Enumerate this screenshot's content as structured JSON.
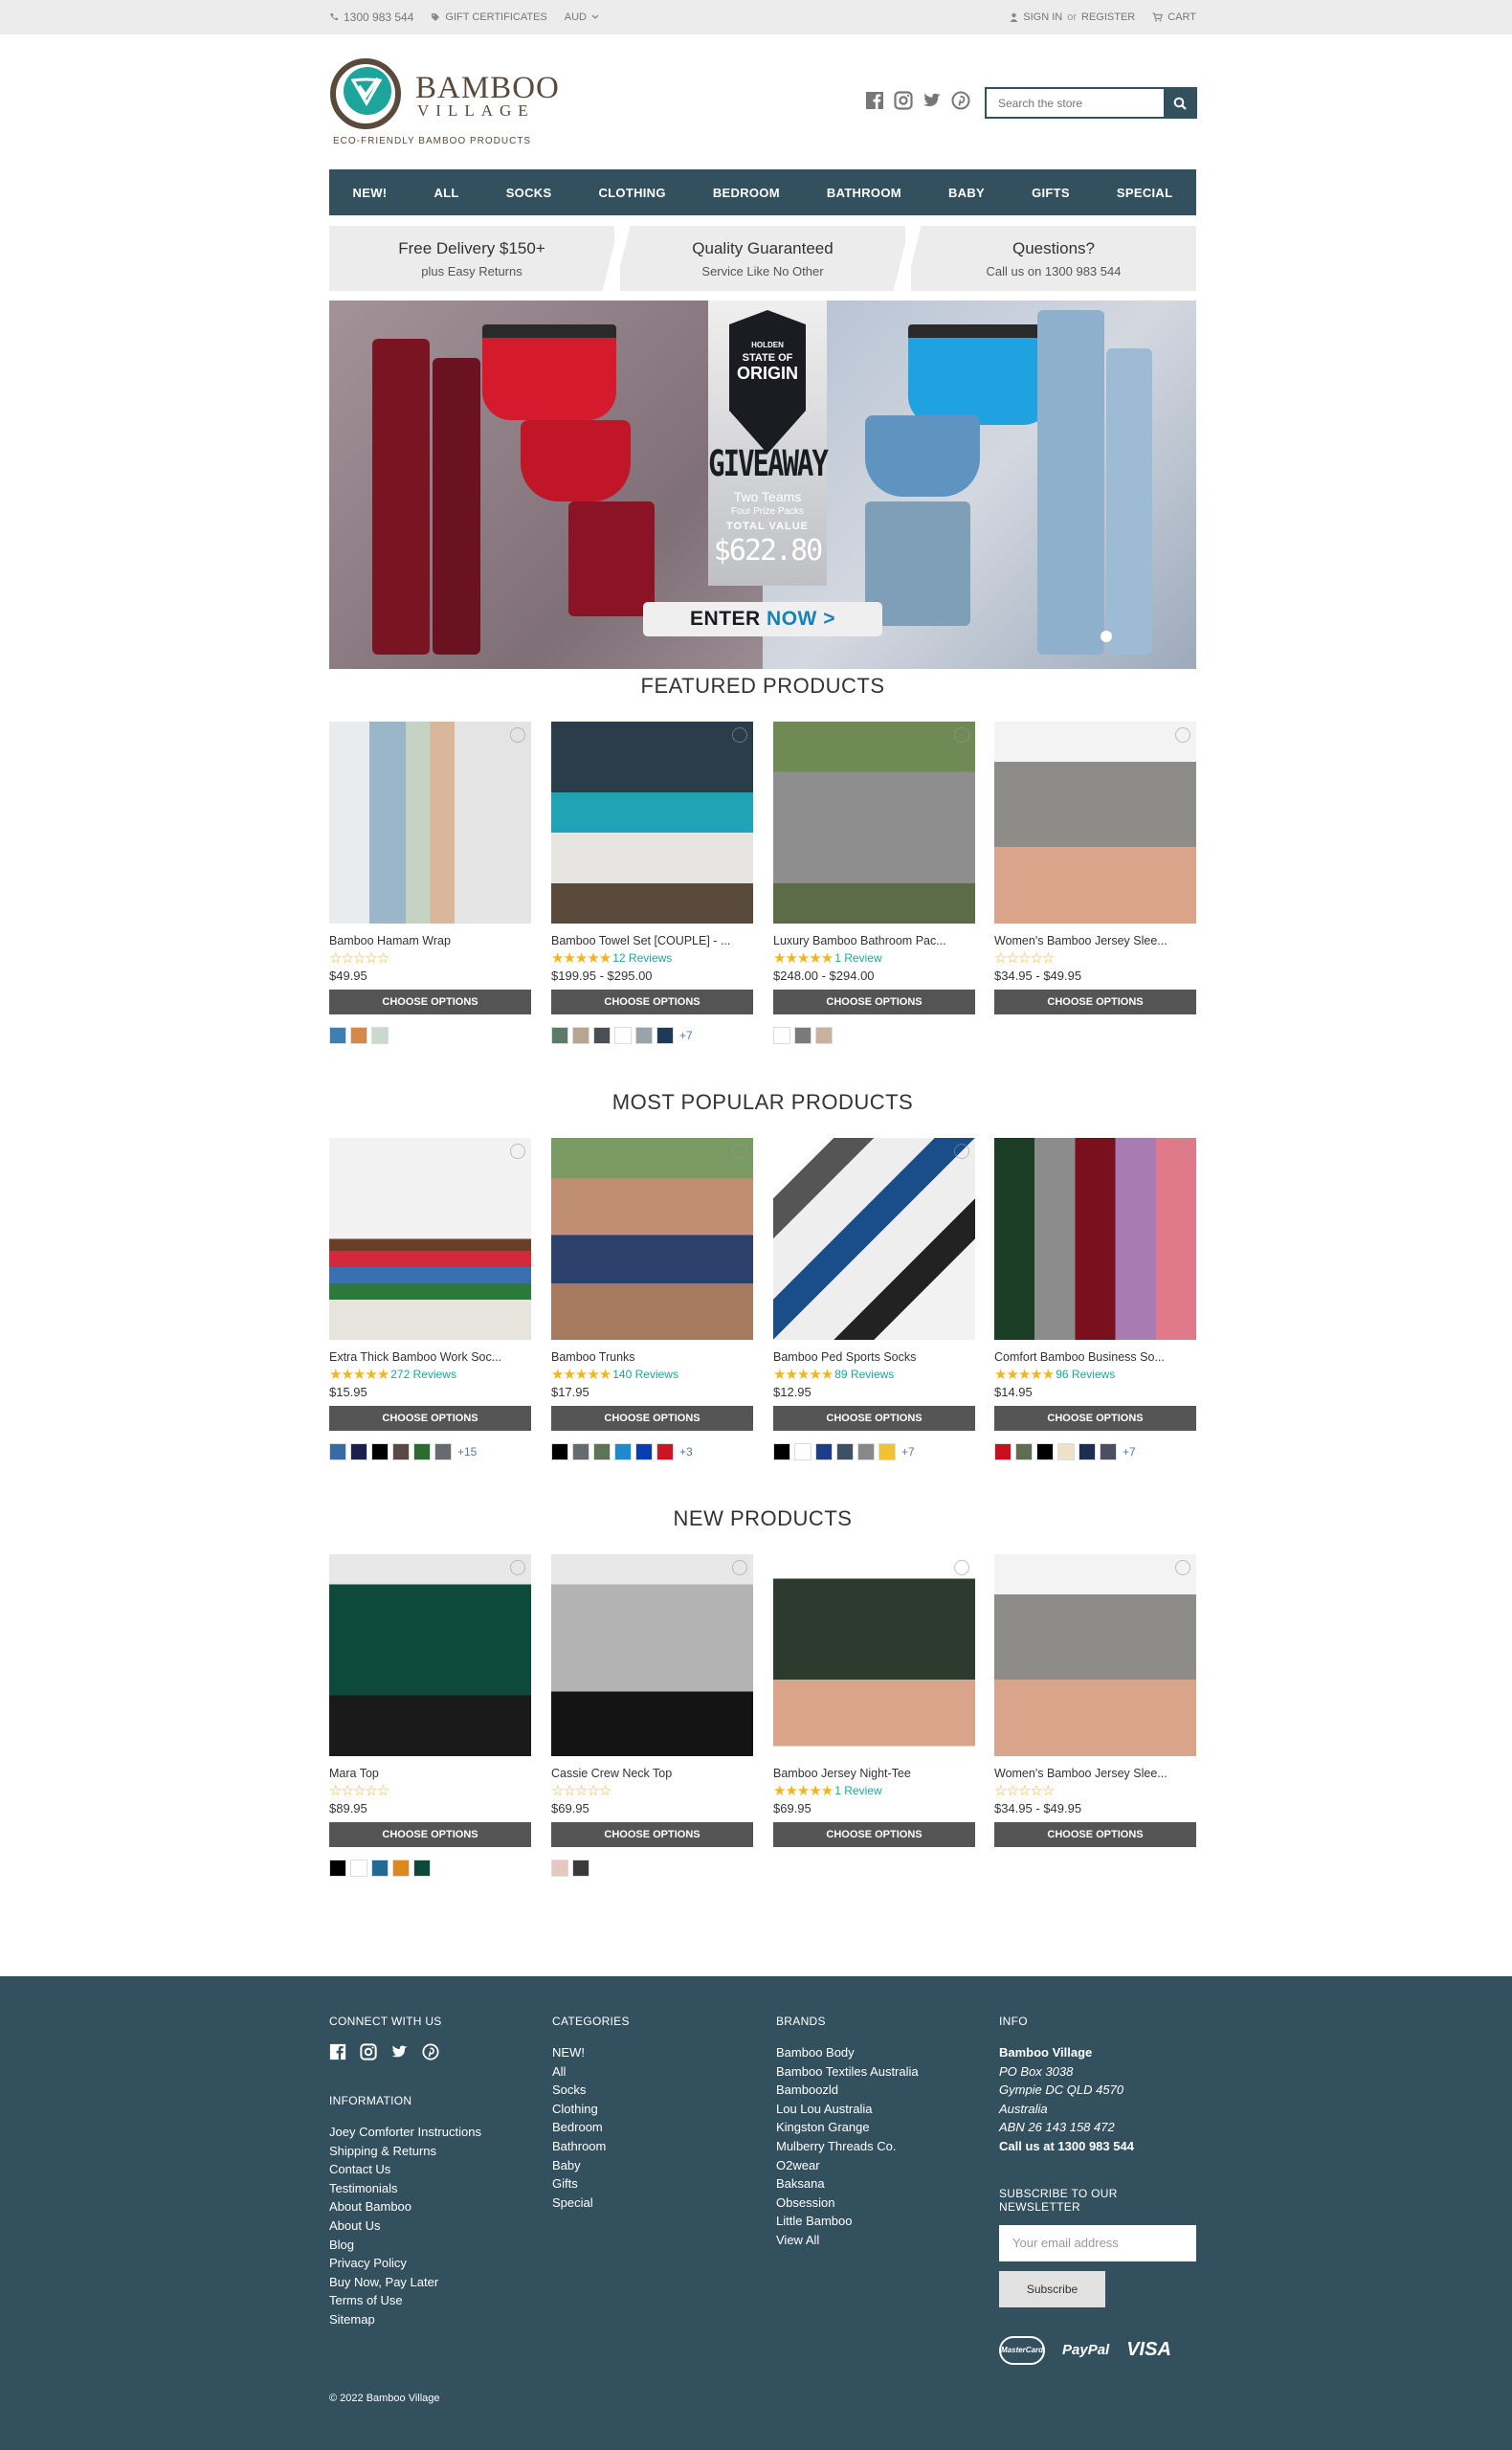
{
  "topbar": {
    "phone": "1300 983 544",
    "gift": "GIFT CERTIFICATES",
    "currency": "AUD",
    "sign_in": "SIGN IN",
    "or": "or",
    "register": "REGISTER",
    "cart": "CART"
  },
  "logo": {
    "word1": "BAMBOO",
    "word2": "VILLAGE",
    "tagline": "ECO-FRIENDLY BAMBOO PRODUCTS"
  },
  "search": {
    "placeholder": "Search the store"
  },
  "nav": [
    "NEW!",
    "ALL",
    "SOCKS",
    "CLOTHING",
    "BEDROOM",
    "BATHROOM",
    "BABY",
    "GIFTS",
    "SPECIAL"
  ],
  "usp": [
    {
      "title": "Free Delivery $150+",
      "sub": "plus Easy Returns"
    },
    {
      "title": "Quality Guaranteed",
      "sub": "Service Like No Other"
    },
    {
      "title": "Questions?",
      "sub": "Call us on 1300 983 544"
    }
  ],
  "hero": {
    "line1": "HOLDEN",
    "line2": "STATE OF",
    "line3": "ORIGIN",
    "giveaway": "GIVEAWAY",
    "sub1": "Two Teams",
    "sub2": "Four Prize Packs",
    "value_label": "TOTAL VALUE",
    "value": "$622.80",
    "cta_a": "ENTER ",
    "cta_b": "NOW >"
  },
  "sections": {
    "featured": "FEATURED PRODUCTS",
    "popular": "MOST POPULAR PRODUCTS",
    "new": "NEW PRODUCTS"
  },
  "featured": [
    {
      "name": "Bamboo Hamam Wrap",
      "stars": "☆☆☆☆☆",
      "reviews": "",
      "price": "$49.95",
      "button": "CHOOSE OPTIONS",
      "swatches": [
        "#3d7fb3",
        "#d4884a",
        "#c9d9cc"
      ],
      "more": ""
    },
    {
      "name": "Bamboo Towel Set [COUPLE] - ...",
      "stars": "★★★★★",
      "reviews": "12 Reviews",
      "price": "$199.95 - $295.00",
      "button": "CHOOSE OPTIONS",
      "swatches": [
        "#5b7a6a",
        "#b7a58f",
        "#4a4f55",
        "#ffffff",
        "#9aa3aa",
        "#1f3a57"
      ],
      "more": "+7"
    },
    {
      "name": "Luxury Bamboo Bathroom Pac...",
      "stars": "★★★★★",
      "reviews": "1 Review",
      "price": "$248.00 - $294.00",
      "button": "CHOOSE OPTIONS",
      "swatches": [
        "#ffffff",
        "#7a7a7a",
        "#c9b29d"
      ],
      "more": ""
    },
    {
      "name": "Women's Bamboo Jersey Slee...",
      "stars": "☆☆☆☆☆",
      "reviews": "",
      "price": "$34.95 - $49.95",
      "button": "CHOOSE OPTIONS",
      "swatches": [],
      "more": ""
    }
  ],
  "popular": [
    {
      "name": "Extra Thick Bamboo Work Soc...",
      "stars": "★★★★★",
      "reviews": "272 Reviews",
      "price": "$15.95",
      "button": "CHOOSE OPTIONS",
      "swatches": [
        "#3a69a8",
        "#1a1f4d",
        "#000000",
        "#5a4a44",
        "#2b6b2f",
        "#666b70"
      ],
      "more": "+15"
    },
    {
      "name": "Bamboo Trunks",
      "stars": "★★★★★",
      "reviews": "140 Reviews",
      "price": "$17.95",
      "button": "CHOOSE OPTIONS",
      "swatches": [
        "#000000",
        "#666b70",
        "#5f7457",
        "#1e8ad0",
        "#0a3db3",
        "#cc1422"
      ],
      "more": "+3"
    },
    {
      "name": "Bamboo Ped Sports Socks",
      "stars": "★★★★★",
      "reviews": "89 Reviews",
      "price": "$12.95",
      "button": "CHOOSE OPTIONS",
      "swatches": [
        "#000000",
        "#ffffff",
        "#1b3d8a",
        "#3e4f66",
        "#888888",
        "#f2c230"
      ],
      "more": "+7"
    },
    {
      "name": "Comfort Bamboo Business So...",
      "stars": "★★★★★",
      "reviews": "96 Reviews",
      "price": "$14.95",
      "button": "CHOOSE OPTIONS",
      "swatches": [
        "#c8101e",
        "#5f6e52",
        "#000000",
        "#efe1c9",
        "#1c2e52",
        "#4a4f62"
      ],
      "more": "+7"
    }
  ],
  "newp": [
    {
      "name": "Mara Top",
      "stars": "☆☆☆☆☆",
      "reviews": "",
      "price": "$89.95",
      "button": "CHOOSE OPTIONS",
      "swatches": [
        "#000000",
        "#ffffff",
        "#1f6b96",
        "#dd8a1c",
        "#0d4a3b"
      ],
      "more": ""
    },
    {
      "name": "Cassie Crew Neck Top",
      "stars": "☆☆☆☆☆",
      "reviews": "",
      "price": "$69.95",
      "button": "CHOOSE OPTIONS",
      "swatches": [
        "#e6c8c0",
        "#3a3a3a"
      ],
      "more": ""
    },
    {
      "name": "Bamboo Jersey Night-Tee",
      "stars": "★★★★★",
      "reviews": "1 Review",
      "price": "$69.95",
      "button": "CHOOSE OPTIONS",
      "swatches": [],
      "more": ""
    },
    {
      "name": "Women's Bamboo Jersey Slee...",
      "stars": "☆☆☆☆☆",
      "reviews": "",
      "price": "$34.95 - $49.95",
      "button": "CHOOSE OPTIONS",
      "swatches": [],
      "more": ""
    }
  ],
  "footer": {
    "connect": "CONNECT WITH US",
    "information": "INFORMATION",
    "info_links": [
      "Joey Comforter Instructions",
      "Shipping & Returns",
      "Contact Us",
      "Testimonials",
      "About Bamboo",
      "About Us",
      "Blog",
      "Privacy Policy",
      "Buy Now, Pay Later",
      "Terms of Use",
      "Sitemap"
    ],
    "categories": "CATEGORIES",
    "cat_links": [
      "NEW!",
      "All",
      "Socks",
      "Clothing",
      "Bedroom",
      "Bathroom",
      "Baby",
      "Gifts",
      "Special"
    ],
    "brands": "BRANDS",
    "brand_links": [
      "Bamboo Body",
      "Bamboo Textiles Australia",
      "Bamboozld",
      "Lou Lou Australia",
      "Kingston Grange",
      "Mulberry Threads Co.",
      "O2wear",
      "Baksana",
      "Obsession",
      "Little Bamboo",
      "View All"
    ],
    "info": "INFO",
    "company": "Bamboo Village",
    "addr1": "PO Box 3038",
    "addr2": "Gympie DC QLD 4570",
    "addr3": "Australia",
    "abn": "ABN 26 143 158 472",
    "call": "Call us at 1300 983 544",
    "newsletter": "SUBSCRIBE TO OUR NEWSLETTER",
    "email_placeholder": "Your email address",
    "subscribe": "Subscribe",
    "pay": [
      "MasterCard",
      "PayPal",
      "VISA"
    ],
    "copyright": "© 2022 Bamboo Village"
  },
  "colors": {
    "brand": "#33505f",
    "accent": "#1ea59b",
    "star": "#f3b51c",
    "button": "#555555"
  }
}
